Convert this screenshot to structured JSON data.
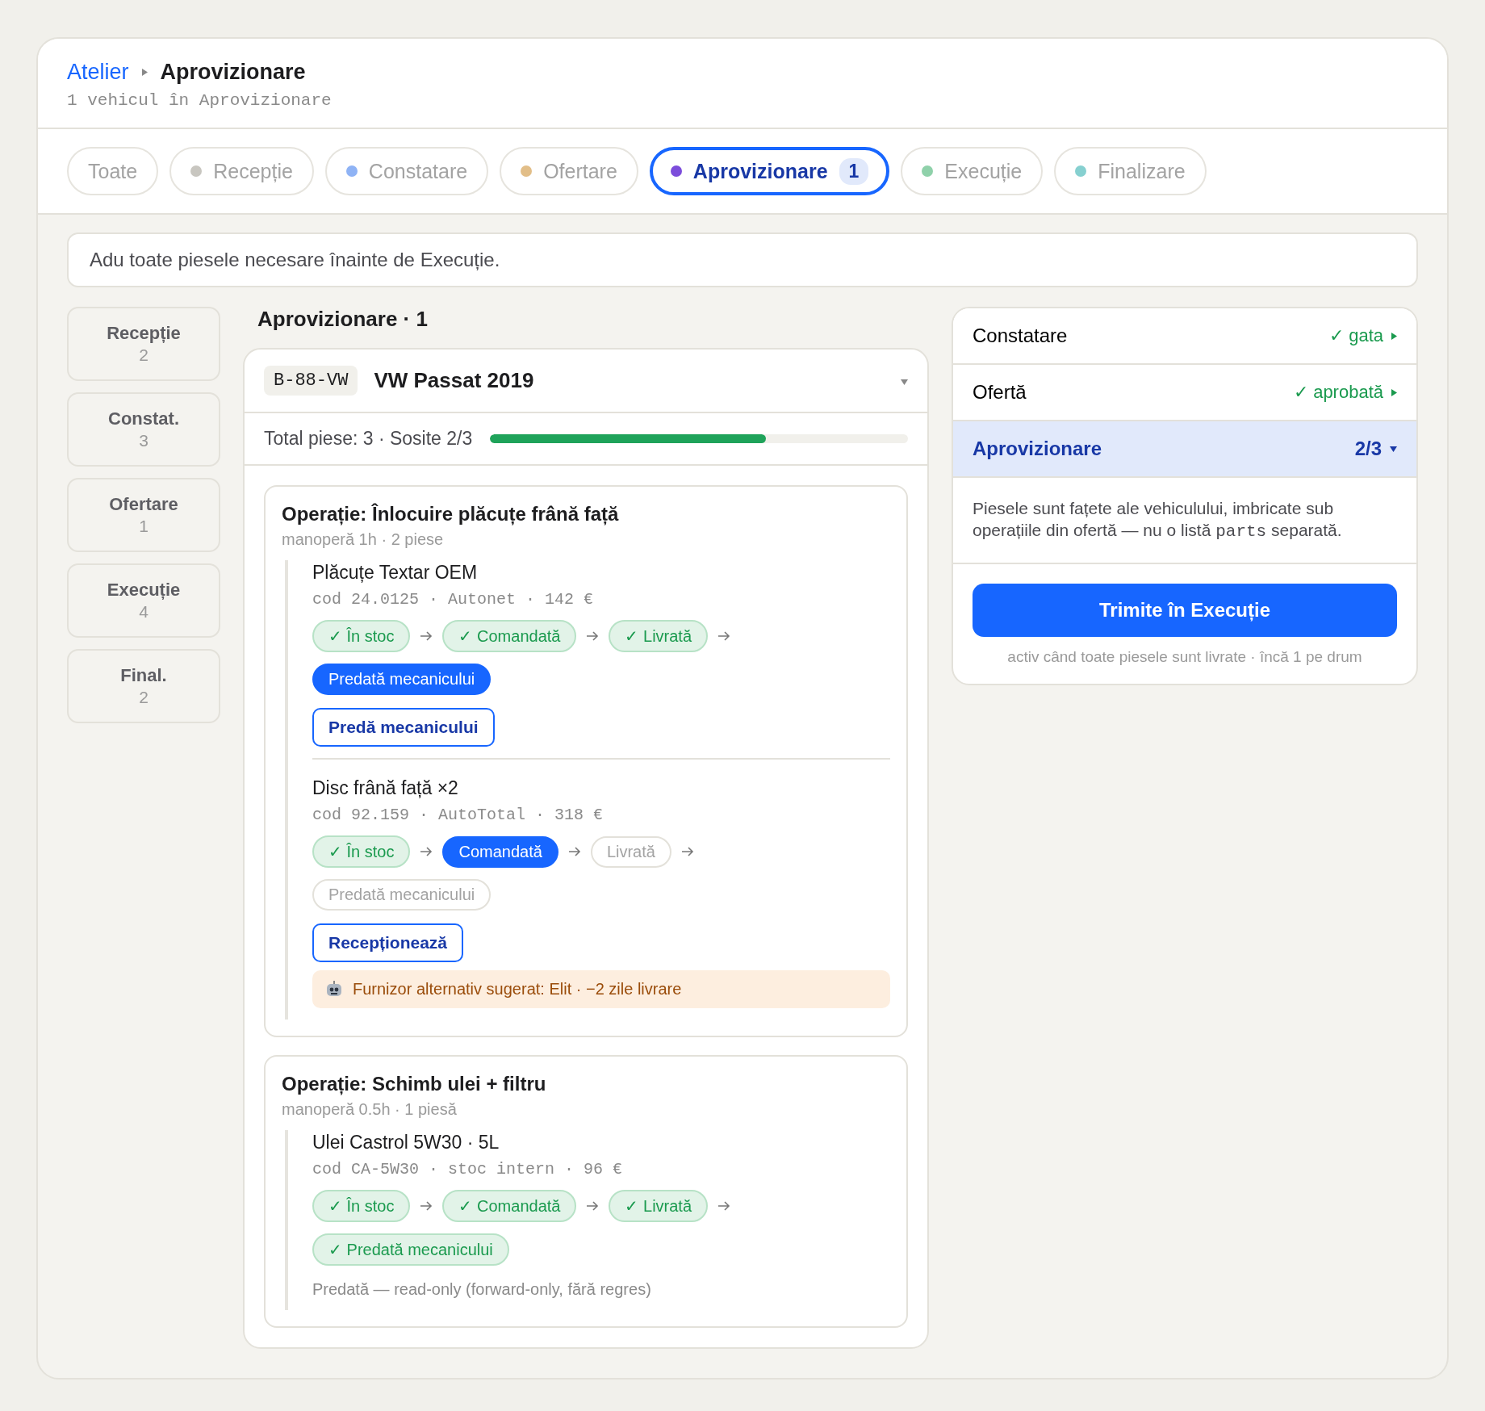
{
  "breadcrumb": {
    "parent": "Atelier",
    "current": "Aprovizionare"
  },
  "subtitle": "1 vehicul în Aprovizionare",
  "tabs": [
    {
      "label": "Toate",
      "selected": false
    },
    {
      "label": "Recepție",
      "color": "#c8c6c0",
      "selected": false
    },
    {
      "label": "Constatare",
      "color": "#8fb3f5",
      "selected": false
    },
    {
      "label": "Ofertare",
      "color": "#e2be88",
      "selected": false
    },
    {
      "label": "Aprovizionare",
      "color": "#7c4ddb",
      "count": "1",
      "selected": true
    },
    {
      "label": "Execuție",
      "color": "#8fd1aa",
      "selected": false
    },
    {
      "label": "Finalizare",
      "color": "#86d0d0",
      "selected": false
    }
  ],
  "banner": "Adu toate piesele necesare înainte de Execuție.",
  "stages": [
    {
      "label": "Recepție",
      "count": "2"
    },
    {
      "label": "Constat.",
      "count": "3"
    },
    {
      "label": "Ofertare",
      "count": "1"
    },
    {
      "label": "Execuție",
      "count": "4"
    },
    {
      "label": "Final.",
      "count": "2"
    }
  ],
  "column_title": "Aprovizionare · 1",
  "vehicle": {
    "plate": "B-88-VW",
    "name": "VW Passat 2019",
    "expanded": true,
    "summary": "Total piese: 3 · Sosite 2/3",
    "level": 0.66,
    "operations": [
      {
        "title": "Operație: Înlocuire plăcuțe frână față",
        "meta": "manoperă 1h · 2 piese",
        "parts": [
          {
            "name": "Plăcuțe Textar OEM",
            "code": "cod 24.0125 · Autonet · 142 €",
            "steps": [
              {
                "label": "✓ În stoc",
                "kind": "done"
              },
              {
                "label": "✓ Comandată",
                "kind": "done"
              },
              {
                "label": "✓ Livrată",
                "kind": "done"
              },
              {
                "label": "Predată mecanicului",
                "kind": "current"
              }
            ],
            "action": "Predă mecanicului"
          },
          {
            "name": "Disc frână față ×2",
            "code": "cod 92.159 · AutoTotal · 318 €",
            "steps": [
              {
                "label": "✓ În stoc",
                "kind": "done"
              },
              {
                "label": "Comandată",
                "kind": "current"
              },
              {
                "label": "Livrată",
                "kind": "pending"
              },
              {
                "label": "Predată mecanicului",
                "kind": "pending"
              }
            ],
            "action": "Recepționează",
            "suggestion": "Furnizor alternativ sugerat: Elit · −2 zile livrare"
          }
        ]
      },
      {
        "title": "Operație: Schimb ulei + filtru",
        "meta": "manoperă 0.5h · 1 piesă",
        "parts": [
          {
            "name": "Ulei Castrol 5W30 · 5L",
            "code": "cod CA-5W30 · stoc intern · 96 €",
            "steps": [
              {
                "label": "✓ În stoc",
                "kind": "done"
              },
              {
                "label": "✓ Comandată",
                "kind": "done"
              },
              {
                "label": "✓ Livrată",
                "kind": "done"
              },
              {
                "label": "✓ Predată mecanicului",
                "kind": "done"
              }
            ],
            "note": "Predată — read-only (forward-only, fără regres)"
          }
        ]
      }
    ]
  },
  "panel": {
    "rows": [
      {
        "label": "Constatare",
        "status": "✓ gata",
        "kind": "done",
        "expanded": false
      },
      {
        "label": "Ofertă",
        "status": "✓ aprobată",
        "kind": "done",
        "expanded": false
      },
      {
        "label": "Aprovizionare",
        "status": "2/3",
        "kind": "active",
        "expanded": true
      }
    ],
    "note": [
      {
        "text": "Piesele sunt fațete ale vehiculului, imbricate sub operațiile din ofertă — nu o listă "
      },
      {
        "text": "parts",
        "mono": true
      },
      {
        "text": " separată."
      }
    ],
    "button": "Trimite în Execuție",
    "hint": "activ când toate piesele sunt livrate · încă 1 pe drum"
  }
}
